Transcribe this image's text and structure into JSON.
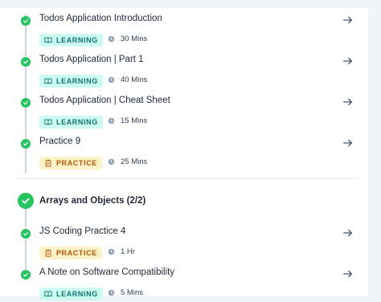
{
  "items_top": [
    {
      "title": "Todos Application Introduction",
      "type": "LEARNING",
      "duration": "30 Mins"
    },
    {
      "title": "Todos Application | Part 1",
      "type": "LEARNING",
      "duration": "40 Mins"
    },
    {
      "title": "Todos Application | Cheat Sheet",
      "type": "LEARNING",
      "duration": "15 Mins"
    },
    {
      "title": "Practice 9",
      "type": "PRACTICE",
      "duration": "25 Mins"
    }
  ],
  "section": {
    "title": "Arrays and Objects (2/2)"
  },
  "items_bottom": [
    {
      "title": "JS Coding Practice 4",
      "type": "PRACTICE",
      "duration": "1 Hr"
    },
    {
      "title": "A Note on Software Compatibility",
      "type": "LEARNING",
      "duration": "5 Mins"
    }
  ],
  "colors": {
    "complete": "#22c55e",
    "learning_bg": "#ccfbf1",
    "practice_bg": "#fef3c7"
  }
}
